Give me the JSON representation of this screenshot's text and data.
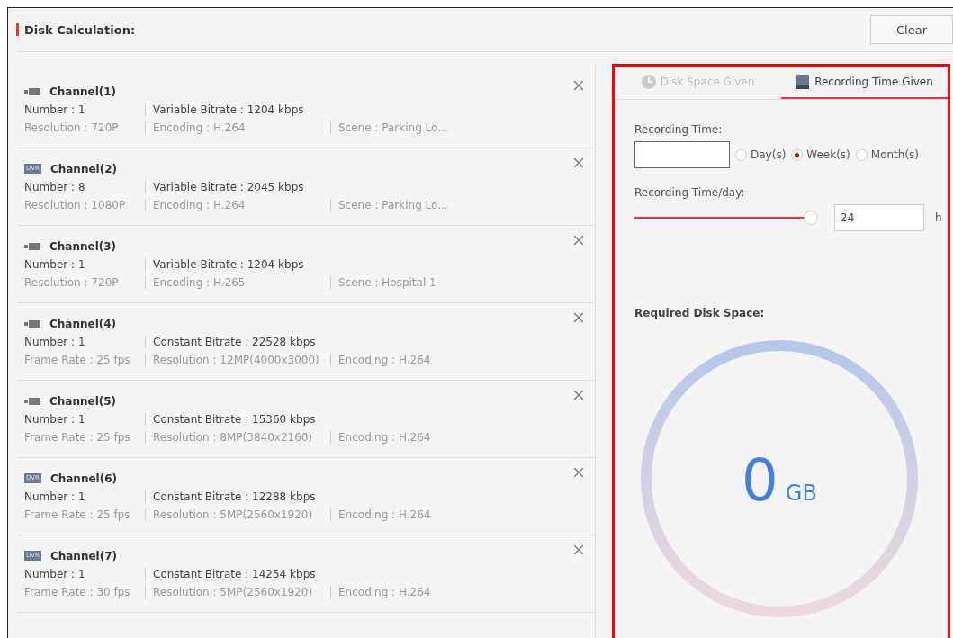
{
  "header": {
    "title": "Disk Calculation:",
    "clear_button": "Clear"
  },
  "channels": [
    {
      "kind": "camera",
      "name": "Channel(1)",
      "line1": [
        "Number : 1",
        "Variable Bitrate : 1204 kbps"
      ],
      "line2": [
        "Resolution : 720P",
        "Encoding : H.264",
        "Scene : Parking Lo..."
      ]
    },
    {
      "kind": "dvr",
      "icon_text": "DVR",
      "name": "Channel(2)",
      "line1": [
        "Number : 8",
        "Variable Bitrate : 2045 kbps"
      ],
      "line2": [
        "Resolution : 1080P",
        "Encoding : H.264",
        "Scene : Parking Lo..."
      ]
    },
    {
      "kind": "camera",
      "name": "Channel(3)",
      "line1": [
        "Number : 1",
        "Variable Bitrate : 1204 kbps"
      ],
      "line2": [
        "Resolution : 720P",
        "Encoding : H.265",
        "Scene : Hospital 1"
      ]
    },
    {
      "kind": "camera",
      "name": "Channel(4)",
      "line1": [
        "Number : 1",
        "Constant Bitrate : 22528 kbps"
      ],
      "line2": [
        "Frame Rate : 25 fps",
        "Resolution : 12MP(4000x3000)",
        "Encoding : H.264"
      ]
    },
    {
      "kind": "camera",
      "name": "Channel(5)",
      "line1": [
        "Number : 1",
        "Constant Bitrate : 15360 kbps"
      ],
      "line2": [
        "Frame Rate : 25 fps",
        "Resolution : 8MP(3840x2160)",
        "Encoding : H.264"
      ]
    },
    {
      "kind": "dvr",
      "icon_text": "DVR",
      "name": "Channel(6)",
      "line1": [
        "Number : 1",
        "Constant Bitrate : 12288 kbps"
      ],
      "line2": [
        "Frame Rate : 25 fps",
        "Resolution : 5MP(2560x1920)",
        "Encoding : H.264"
      ]
    },
    {
      "kind": "dvr",
      "icon_text": "DVR",
      "name": "Channel(7)",
      "line1": [
        "Number : 1",
        "Constant Bitrate : 14254 kbps"
      ],
      "line2": [
        "Frame Rate : 30 fps",
        "Resolution : 5MP(2560x1920)",
        "Encoding : H.264"
      ]
    }
  ],
  "tabs": [
    {
      "kind": "clock",
      "label": "Disk Space Given",
      "selected": false
    },
    {
      "kind": "disk",
      "label": "Recording Time Given",
      "selected": true
    }
  ],
  "recording_time": {
    "label": "Recording Time:",
    "units": [
      {
        "label": "Day(s)",
        "selected": false
      },
      {
        "label": "Week(s)",
        "selected": true
      },
      {
        "label": "Month(s)",
        "selected": false
      }
    ]
  },
  "time_per_day": {
    "label": "Recording Time/day:",
    "level": 1,
    "value": "24",
    "unit": "h"
  },
  "result": {
    "label": "Required Disk Space:",
    "value": "0",
    "unit": "GB"
  }
}
